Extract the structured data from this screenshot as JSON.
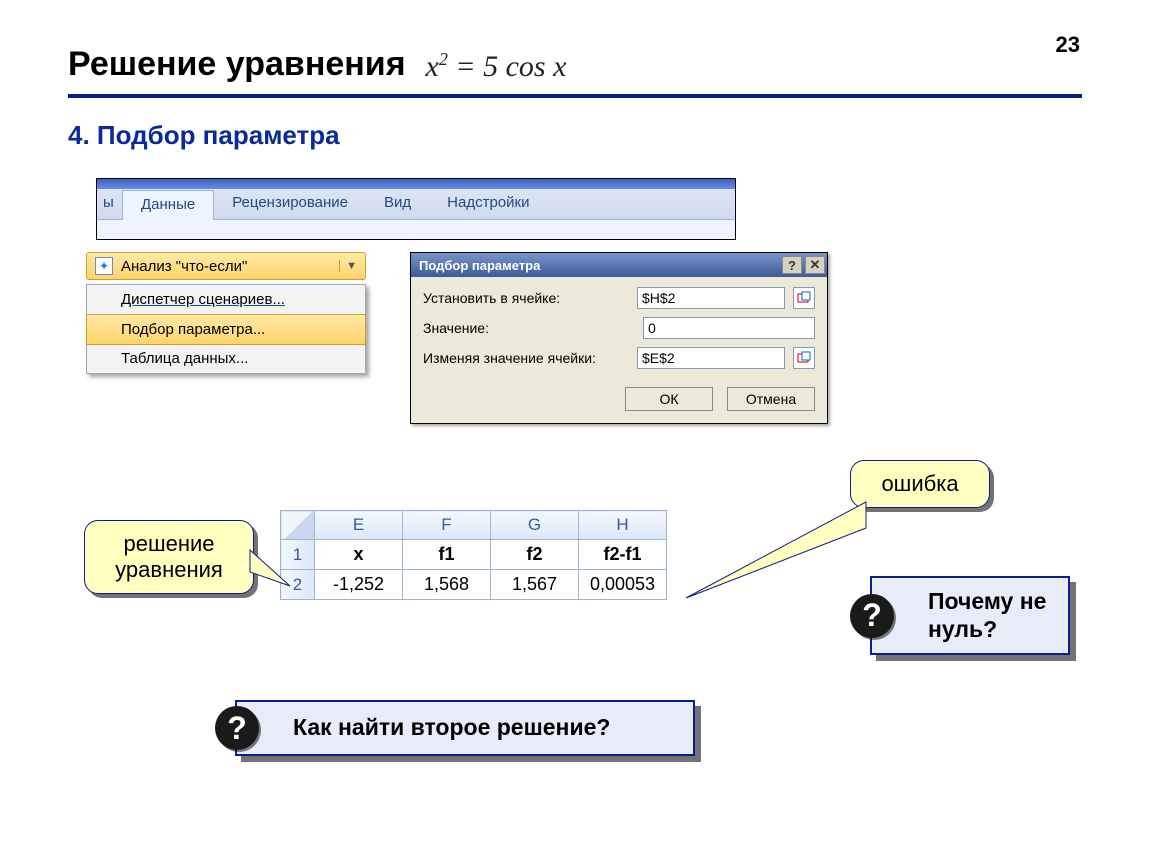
{
  "page_number": "23",
  "title": "Решение уравнения",
  "equation_html": "x² = 5 cos x",
  "subtitle": "4. Подбор параметра",
  "ribbon": {
    "tab_cut": "ы",
    "tab_active": "Данные",
    "tab2": "Рецензирование",
    "tab3": "Вид",
    "tab4": "Надстройки"
  },
  "whatif": {
    "button": "Анализ \"что-если\"",
    "mi1": "Диспетчер сценариев...",
    "mi2": "Подбор параметра...",
    "mi3": "Таблица данных..."
  },
  "dialog": {
    "title": "Подбор параметра",
    "lbl_setcell": "Установить в ячейке:",
    "val_setcell": "$H$2",
    "lbl_value": "Значение:",
    "val_value": "0",
    "lbl_changing": "Изменяя значение ячейки:",
    "val_changing": "$E$2",
    "ok": "ОК",
    "cancel": "Отмена"
  },
  "sheet": {
    "cols": {
      "c1": "E",
      "c2": "F",
      "c3": "G",
      "c4": "H"
    },
    "rows": {
      "r1": "1",
      "r2": "2"
    },
    "headers": {
      "h1": "x",
      "h2": "f1",
      "h3": "f2",
      "h4": "f2-f1"
    },
    "values": {
      "v1": "-1,252",
      "v2": "1,568",
      "v3": "1,567",
      "v4": "0,00053"
    }
  },
  "labels": {
    "solution": "решение уравнения",
    "error": "ошибка",
    "why": "Почему не нуль?",
    "how": "Как найти второе решение?"
  }
}
